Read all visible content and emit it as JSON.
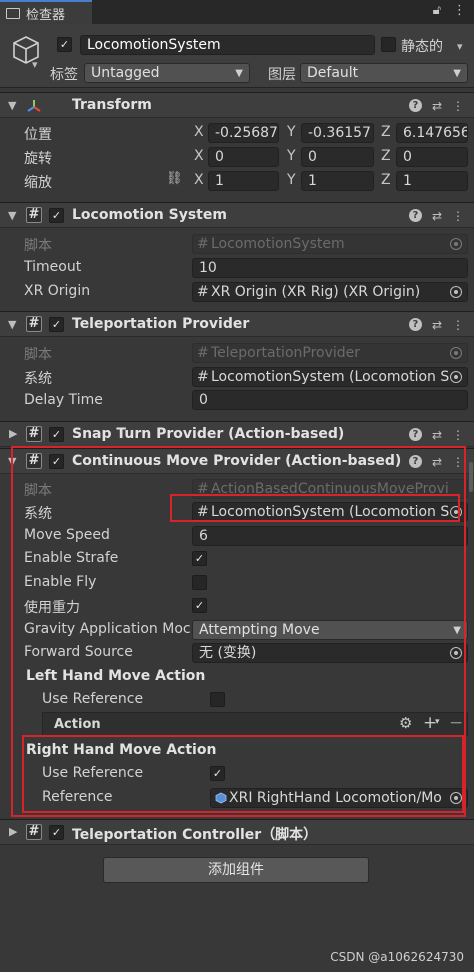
{
  "tab": {
    "title": "检查器"
  },
  "object": {
    "name": "LocomotionSystem",
    "static_label": "静态的",
    "tag_label": "标签",
    "tag_value": "Untagged",
    "layer_label": "图层",
    "layer_value": "Default"
  },
  "transform": {
    "title": "Transform",
    "rows": [
      {
        "label": "位置",
        "x": "-0.25687",
        "y": "-0.36157",
        "z": "6.147656"
      },
      {
        "label": "旋转",
        "x": "0",
        "y": "0",
        "z": "0"
      },
      {
        "label": "缩放",
        "x": "1",
        "y": "1",
        "z": "1"
      }
    ],
    "axes": {
      "x": "X",
      "y": "Y",
      "z": "Z"
    }
  },
  "locomotion": {
    "title": "Locomotion System",
    "script_label": "脚本",
    "script_value": "LocomotionSystem",
    "timeout_label": "Timeout",
    "timeout_value": "10",
    "xr_origin_label": "XR Origin",
    "xr_origin_value": "XR Origin (XR Rig) (XR Origin)"
  },
  "teleport": {
    "title": "Teleportation Provider",
    "script_label": "脚本",
    "script_value": "TeleportationProvider",
    "system_label": "系统",
    "system_value": "LocomotionSystem (Locomotion S",
    "delay_label": "Delay Time",
    "delay_value": "0"
  },
  "snap": {
    "title": "Snap Turn Provider (Action-based)"
  },
  "continuous": {
    "title": "Continuous Move Provider (Action-based)",
    "script_label": "脚本",
    "script_value": "ActionBasedContinuousMoveProvi",
    "system_label": "系统",
    "system_value": "LocomotionSystem (Locomotion S",
    "speed_label": "Move Speed",
    "speed_value": "6",
    "strafe_label": "Enable Strafe",
    "fly_label": "Enable Fly",
    "gravity_label": "使用重力",
    "gravity_app_label": "Gravity Application Moc",
    "gravity_app_value": "Attempting Move",
    "forward_label": "Forward Source",
    "forward_value": "无 (变换)",
    "left_title": "Left Hand Move Action",
    "left_use_ref_label": "Use Reference",
    "left_action_label": "Action",
    "right_title": "Right Hand Move Action",
    "right_use_ref_label": "Use Reference",
    "right_ref_label": "Reference",
    "right_ref_value": "XRI RightHand Locomotion/Mo"
  },
  "teleport_ctrl": {
    "title": "Teleportation Controller",
    "suffix": "（脚本）"
  },
  "add_component": "添加组件",
  "watermark": "CSDN @a1062624730",
  "colors": {
    "highlight": "#d6242a",
    "accent": "#4a7fd0"
  }
}
